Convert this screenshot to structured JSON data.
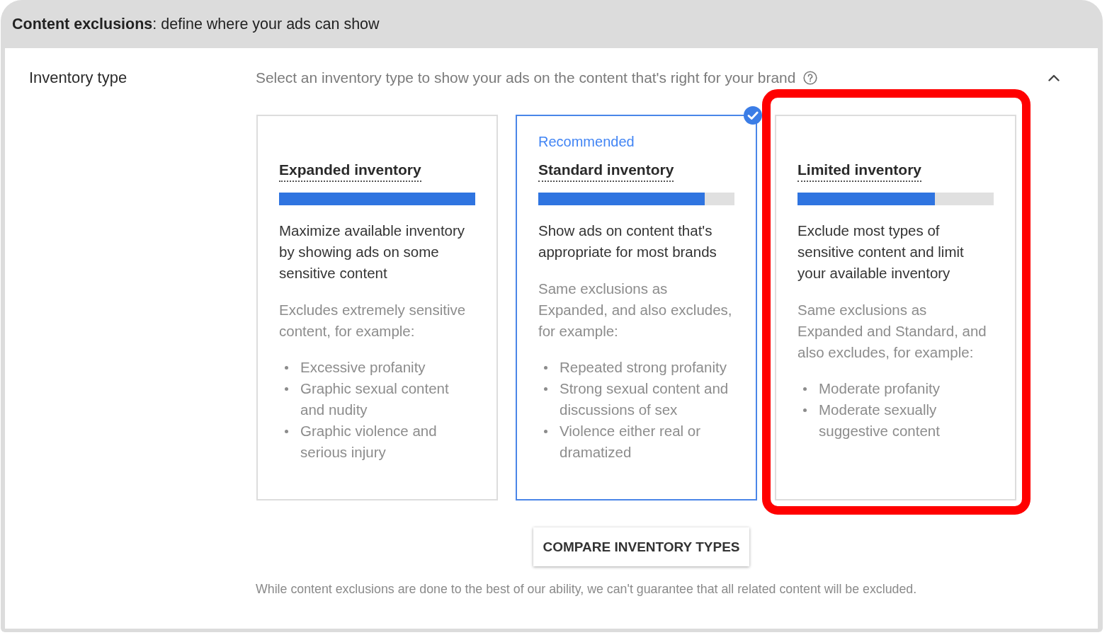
{
  "header": {
    "title": "**Content exclusions**: define where your ads can show"
  },
  "section": {
    "label": "Inventory type",
    "description": "Select an inventory type to show your ads on the content that's right for your brand",
    "expanded": true
  },
  "tiers": [
    {
      "title": "Expanded inventory",
      "level": 1,
      "summary": "Maximize available inventory by showing ads on some sensitive content",
      "details": "Excludes extremely sensitive content, for example:",
      "examples": [
        "Excessive profanity",
        "Graphic sexual content and nudity",
        "Graphic violence and serious injury"
      ],
      "selected": false,
      "highlighted": false
    },
    {
      "badge": "Recommended",
      "title": "Standard inventory",
      "level": 0.85,
      "summary": "Show ads on content that's appropriate for most brands",
      "details": "Same exclusions as Expanded, and also excludes, for example:",
      "examples": [
        "Repeated strong profanity",
        "Strong sexual content and discussions of sex",
        "Violence either real or dramatized"
      ],
      "selected": true,
      "highlighted": false
    },
    {
      "title": "Limited inventory",
      "level": 0.7,
      "summary": "Exclude most types of sensitive content and limit your available inventory",
      "details": "Same exclusions as Expanded and Standard, and also excludes, for example:",
      "examples": [
        "Moderate profanity",
        "Moderate sexually suggestive content"
      ],
      "selected": false,
      "highlighted": true
    }
  ],
  "compare_button": "COMPARE INVENTORY TYPES",
  "disclaimer": "While content exclusions are done to the best of our ability, we can't guarantee that all related content will be excluded."
}
